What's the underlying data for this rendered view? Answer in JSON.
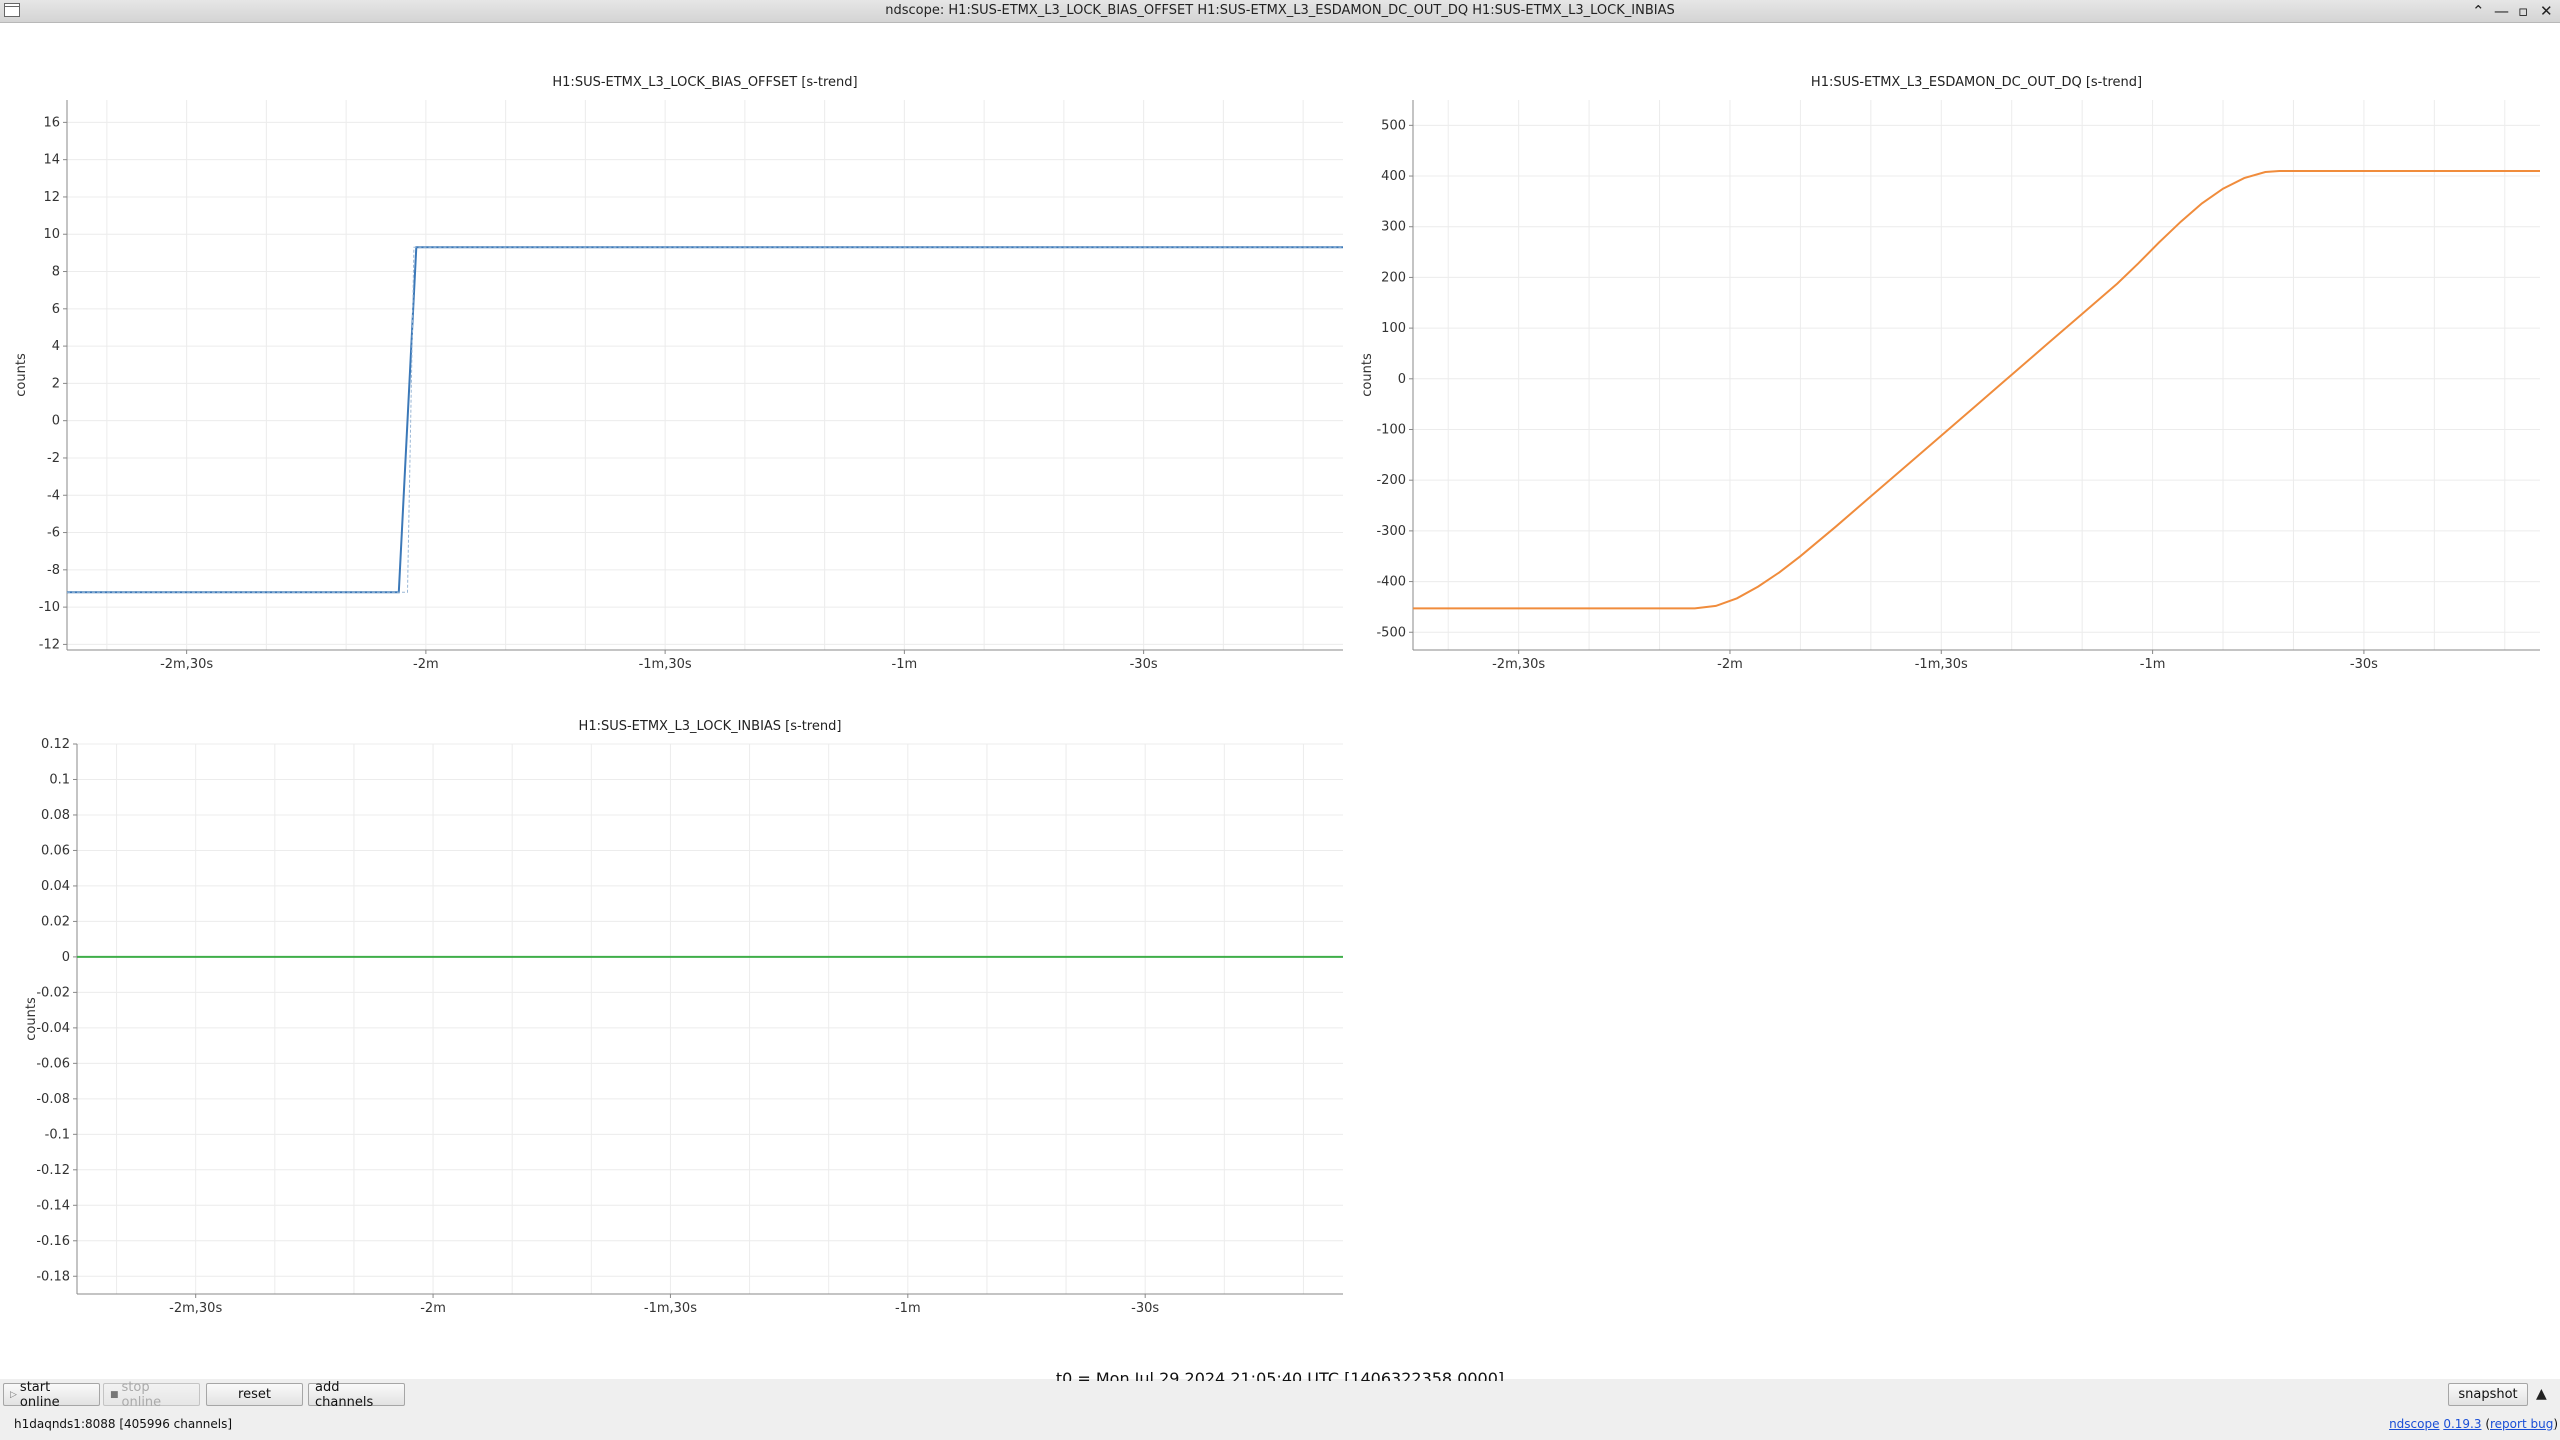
{
  "window": {
    "title": "ndscope: H1:SUS-ETMX_L3_LOCK_BIAS_OFFSET H1:SUS-ETMX_L3_ESDAMON_DC_OUT_DQ H1:SUS-ETMX_L3_LOCK_INBIAS",
    "minimize_glyph": "⌃",
    "restore_glyph": "—",
    "maximize_glyph": "▫",
    "close_glyph": "✕"
  },
  "colors": {
    "series_blue": "#3b78b8",
    "series_orange": "#f08c3c",
    "series_green": "#3fae49",
    "grid": "#ececec"
  },
  "t0_label": "t0 = Mon Jul 29 2024 21:05:40 UTC [1406322358.0000]",
  "toolbar": {
    "start_online": "start online",
    "stop_online": "stop online",
    "reset": "reset",
    "add_channels": "add channels",
    "snapshot": "snapshot",
    "expand_glyph": "▲",
    "play_glyph": "▷",
    "stop_glyph": "■"
  },
  "status": {
    "server": "h1daqnds1:8088  [405996 channels]",
    "app_name": "ndscope",
    "version": "0.19.3",
    "report_bug": "report bug"
  },
  "chart_data": [
    {
      "type": "line",
      "title": "H1:SUS-ETMX_L3_LOCK_BIAS_OFFSET [s-trend]",
      "ylabel": "counts",
      "xlim": [
        -165,
        -5
      ],
      "ylim": [
        -12.3,
        17.2
      ],
      "xticks": [
        {
          "v": -150,
          "label": "-2m,30s"
        },
        {
          "v": -120,
          "label": "-2m"
        },
        {
          "v": -90,
          "label": "-1m,30s"
        },
        {
          "v": -60,
          "label": "-1m"
        },
        {
          "v": -30,
          "label": "-30s"
        }
      ],
      "yticks": [
        16,
        14,
        12,
        10,
        8,
        6,
        4,
        2,
        0,
        -2,
        -4,
        -6,
        -8,
        -10,
        -12
      ],
      "grid": true,
      "series": [
        {
          "color": "#3b78b8",
          "points": [
            [
              -165,
              -9.2
            ],
            [
              -123.4,
              -9.2
            ],
            [
              -121.2,
              9.3
            ],
            [
              -5,
              9.3
            ]
          ]
        },
        {
          "color": "#9ab7d6",
          "dashed": true,
          "points": [
            [
              -165,
              -9.2
            ],
            [
              -122.3,
              -9.2
            ],
            [
              -121.5,
              9.3
            ],
            [
              -5,
              9.3
            ]
          ]
        }
      ]
    },
    {
      "type": "line",
      "title": "H1:SUS-ETMX_L3_ESDAMON_DC_OUT_DQ [s-trend]",
      "ylabel": "counts",
      "xlim": [
        -165,
        -5
      ],
      "ylim": [
        -535,
        550
      ],
      "xticks": [
        {
          "v": -150,
          "label": "-2m,30s"
        },
        {
          "v": -120,
          "label": "-2m"
        },
        {
          "v": -90,
          "label": "-1m,30s"
        },
        {
          "v": -60,
          "label": "-1m"
        },
        {
          "v": -30,
          "label": "-30s"
        }
      ],
      "yticks": [
        500,
        400,
        300,
        200,
        100,
        0,
        -100,
        -200,
        -300,
        -400,
        -500
      ],
      "grid": true,
      "series": [
        {
          "color": "#f08c3c",
          "points": [
            [
              -165,
              -453
            ],
            [
              -125,
              -453
            ],
            [
              -122,
              -448
            ],
            [
              -119,
              -433
            ],
            [
              -116,
              -410
            ],
            [
              -113,
              -382
            ],
            [
              -110,
              -350
            ],
            [
              -105,
              -292
            ],
            [
              -100,
              -232
            ],
            [
              -95,
              -172
            ],
            [
              -90,
              -112
            ],
            [
              -85,
              -52
            ],
            [
              -80,
              8
            ],
            [
              -75,
              68
            ],
            [
              -70,
              128
            ],
            [
              -65,
              188
            ],
            [
              -62,
              228
            ],
            [
              -59,
              270
            ],
            [
              -56,
              310
            ],
            [
              -53,
              346
            ],
            [
              -50,
              375
            ],
            [
              -47,
              396
            ],
            [
              -44,
              408
            ],
            [
              -42,
              410
            ],
            [
              -5,
              410
            ]
          ]
        }
      ]
    },
    {
      "type": "line",
      "title": "H1:SUS-ETMX_L3_LOCK_INBIAS [s-trend]",
      "ylabel": "counts",
      "xlim": [
        -165,
        -5
      ],
      "ylim": [
        -0.19,
        0.12
      ],
      "xticks": [
        {
          "v": -150,
          "label": "-2m,30s"
        },
        {
          "v": -120,
          "label": "-2m"
        },
        {
          "v": -90,
          "label": "-1m,30s"
        },
        {
          "v": -60,
          "label": "-1m"
        },
        {
          "v": -30,
          "label": "-30s"
        }
      ],
      "yticks": [
        0.12,
        0.1,
        0.08,
        0.06,
        0.04,
        0.02,
        0,
        -0.02,
        -0.04,
        -0.06,
        -0.08,
        -0.1,
        -0.12,
        -0.14,
        -0.16,
        -0.18
      ],
      "grid": true,
      "series": [
        {
          "color": "#3fae49",
          "points": [
            [
              -165,
              0
            ],
            [
              -5,
              0
            ]
          ]
        }
      ]
    }
  ]
}
